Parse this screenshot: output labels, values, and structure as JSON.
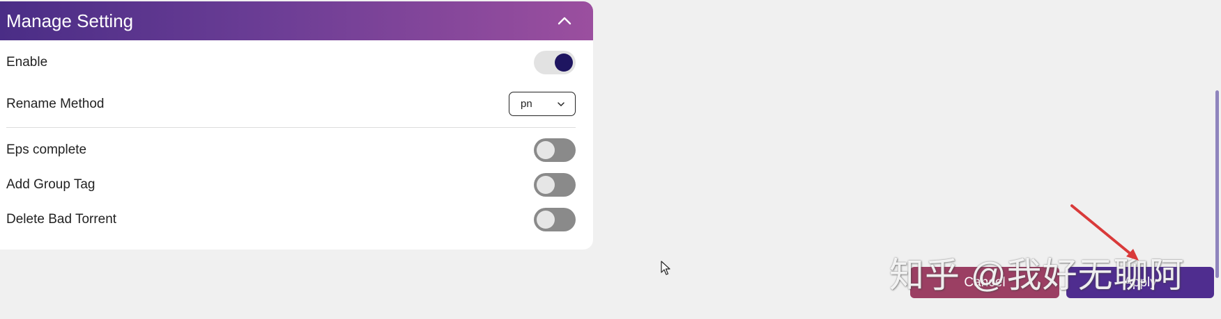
{
  "panel": {
    "title": "Manage Setting",
    "collapse_icon": "chevron-up-icon"
  },
  "settings": {
    "enable": {
      "label": "Enable",
      "value": true
    },
    "rename_method": {
      "label": "Rename Method",
      "value": "pn",
      "icon": "chevron-down-icon"
    },
    "eps_complete": {
      "label": "Eps complete",
      "value": false
    },
    "add_group_tag": {
      "label": "Add Group Tag",
      "value": false
    },
    "delete_bad_torrent": {
      "label": "Delete Bad Torrent",
      "value": false
    }
  },
  "actions": {
    "cancel_label": "Cancel",
    "apply_label": "Apply"
  },
  "overlay": {
    "watermark": "知乎 @我好无聊阿",
    "annotation_color": "#d93a3a"
  },
  "colors": {
    "header_gradient_start": "#4a2d86",
    "header_gradient_end": "#9b4f9f",
    "toggle_on_knob": "#1e1560",
    "cancel_bg": "#9b3f63",
    "apply_bg": "#4f2d8f"
  }
}
